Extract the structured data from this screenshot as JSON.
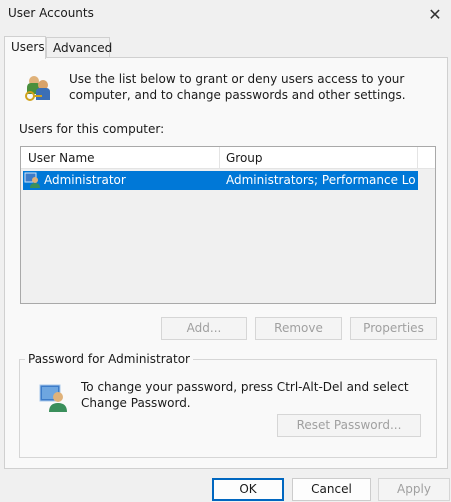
{
  "window": {
    "title": "User Accounts"
  },
  "tabs": [
    {
      "label": "Users",
      "active": true
    },
    {
      "label": "Advanced",
      "active": false
    }
  ],
  "intro": "Use the list below to grant or deny users access to your computer, and to change passwords and other settings.",
  "users_list": {
    "label": "Users for this computer:",
    "columns": [
      "User Name",
      "Group"
    ],
    "rows": [
      {
        "user": "Administrator",
        "group": "Administrators; Performance Log...",
        "selected": true
      }
    ]
  },
  "list_buttons": {
    "add": "Add...",
    "remove": "Remove",
    "properties": "Properties"
  },
  "password_group": {
    "title": "Password for Administrator",
    "text": "To change your password, press Ctrl-Alt-Del and select Change Password.",
    "reset_button": "Reset Password..."
  },
  "dialog_buttons": {
    "ok": "OK",
    "cancel": "Cancel",
    "apply": "Apply"
  },
  "icons": {
    "close": "close-icon",
    "users": "users-icon",
    "user_row": "user-icon",
    "password": "user-password-icon"
  },
  "colors": {
    "selection": "#0078d7",
    "default_button_border": "#0067c0"
  }
}
